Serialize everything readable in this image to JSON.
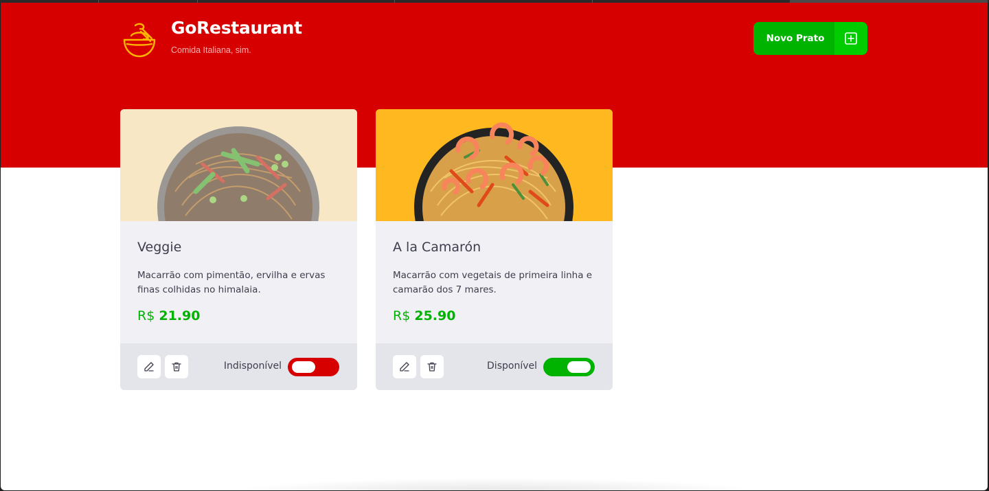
{
  "app": {
    "title": "GoRestaurant",
    "subtitle": "Comida Italiana, sim.",
    "logo_icon": "bowl-icon"
  },
  "header": {
    "new_dish_label": "Novo Prato",
    "new_dish_icon": "plus-square-icon"
  },
  "colors": {
    "brand_red": "#d60000",
    "accent_green": "#00b300",
    "accent_green_light": "#00cc00",
    "card_bg": "#f0f0f5",
    "card_footer_bg": "#e4e4eb",
    "text_dark": "#3d3d4d"
  },
  "dishes": [
    {
      "name": "Veggie",
      "description": "Macarrão com pimentão, ervilha e ervas finas colhidas no himalaia.",
      "currency": "R$",
      "price": "21.90",
      "available": false,
      "status_label": "Indisponível",
      "image_bg": "#f4dfb1",
      "edit_icon": "pencil-icon",
      "delete_icon": "trash-icon"
    },
    {
      "name": "A la Camarón",
      "description": "Macarrão com vegetais de primeira linha e camarão dos 7 mares.",
      "currency": "R$",
      "price": "25.90",
      "available": true,
      "status_label": "Disponível",
      "image_bg": "#ffb81f",
      "edit_icon": "pencil-icon",
      "delete_icon": "trash-icon"
    }
  ]
}
